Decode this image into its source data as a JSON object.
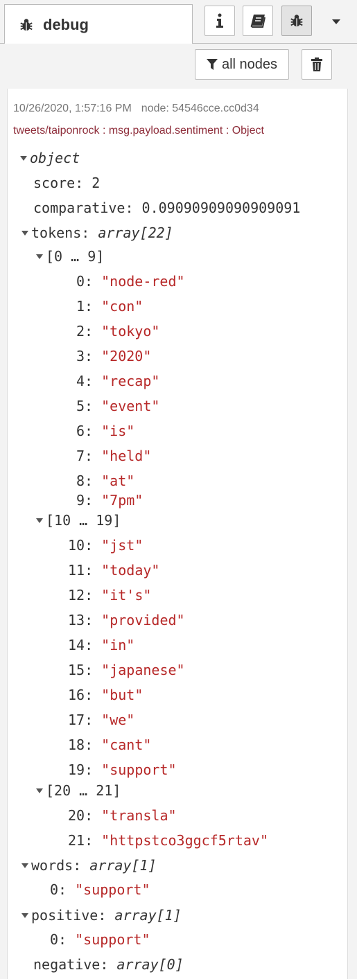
{
  "tab": {
    "label": "debug",
    "icon": "bug-icon"
  },
  "toolbar": {
    "info_icon": "info-icon",
    "book_icon": "book-icon",
    "bug_icon": "bug-icon",
    "menu_icon": "caret-down-icon",
    "filter_label": "all nodes",
    "filter_icon": "filter-icon",
    "clear_icon": "trash-icon"
  },
  "message": {
    "timestamp": "10/26/2020, 1:57:16 PM",
    "node": "node: 54546cce.cc0d34",
    "topic": "tweets/taiponrock : msg.payload.sentiment : Object",
    "root_label": "object",
    "score_key": "score:",
    "score_value": "2",
    "comparative_key": "comparative:",
    "comparative_value": "0.09090909090909091",
    "tokens_key": "tokens:",
    "tokens_type": "array[22]",
    "group1": "[0 … 9]",
    "group2": "[10 … 19]",
    "group3": "[20 … 21]",
    "tokens": [
      {
        "k": "0:",
        "v": "\"node-red\""
      },
      {
        "k": "1:",
        "v": "\"con\""
      },
      {
        "k": "2:",
        "v": "\"tokyo\""
      },
      {
        "k": "3:",
        "v": "\"2020\""
      },
      {
        "k": "4:",
        "v": "\"recap\""
      },
      {
        "k": "5:",
        "v": "\"event\""
      },
      {
        "k": "6:",
        "v": "\"is\""
      },
      {
        "k": "7:",
        "v": "\"held\""
      },
      {
        "k": "8:",
        "v": "\"at\""
      },
      {
        "k": "9:",
        "v": "\"7pm\""
      },
      {
        "k": "10:",
        "v": "\"jst\""
      },
      {
        "k": "11:",
        "v": "\"today\""
      },
      {
        "k": "12:",
        "v": "\"it's\""
      },
      {
        "k": "13:",
        "v": "\"provided\""
      },
      {
        "k": "14:",
        "v": "\"in\""
      },
      {
        "k": "15:",
        "v": "\"japanese\""
      },
      {
        "k": "16:",
        "v": "\"but\""
      },
      {
        "k": "17:",
        "v": "\"we\""
      },
      {
        "k": "18:",
        "v": "\"cant\""
      },
      {
        "k": "19:",
        "v": "\"support\""
      },
      {
        "k": "20:",
        "v": "\"transla\""
      },
      {
        "k": "21:",
        "v": "\"httpstco3ggcf5rtav\""
      }
    ],
    "words_key": "words:",
    "words_type": "array[1]",
    "words": [
      {
        "k": "0:",
        "v": "\"support\""
      }
    ],
    "positive_key": "positive:",
    "positive_type": "array[1]",
    "positive": [
      {
        "k": "0:",
        "v": "\"support\""
      }
    ],
    "negative_key": "negative:",
    "negative_type": "array[0]"
  },
  "colors": {
    "string": "#b72828",
    "topic": "#8e2d3a",
    "meta": "#777777"
  }
}
